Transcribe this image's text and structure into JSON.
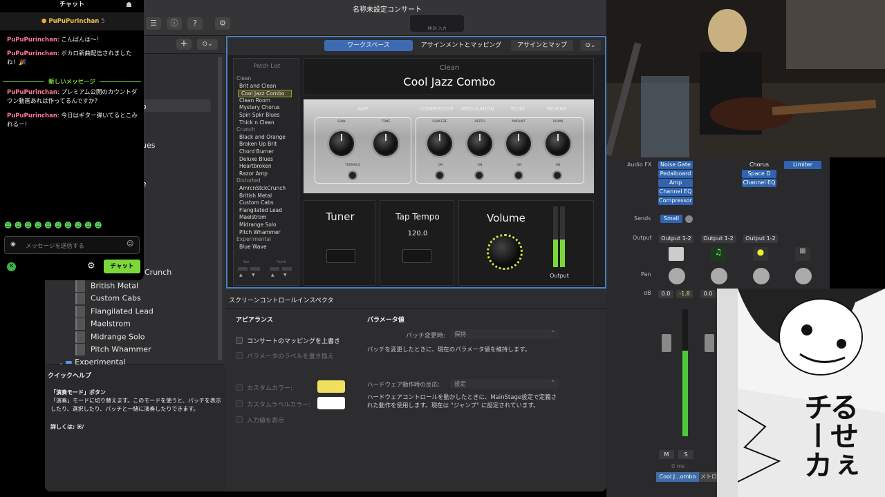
{
  "window": {
    "title": "名称未設定コンサート",
    "midi": "MIDI 入力"
  },
  "chat": {
    "title": "チャット",
    "owner": "PuPuPurinchan",
    "owner_count": "5",
    "messages": [
      {
        "user": "PuPuPurinchan",
        "text": ": こんばんは〜！"
      },
      {
        "user": "PuPuPurinchan",
        "text": ": ボカロ新曲配信されましたね！🎉"
      },
      {
        "user": "PuPuPurinchan",
        "text": ": プレミアム公開のカウントダウン動画あれは作ってるんですか？"
      },
      {
        "user": "PuPuPurinchan",
        "text": ": 今日はギター弾いてるとこみれるー！"
      }
    ],
    "new_divider": "新しいメッセージ",
    "placeholder": "メッセージを送信する",
    "send": "チャット"
  },
  "left": {
    "fragments": [
      "o",
      "ues",
      "e"
    ],
    "items": [
      "Crunch",
      "British Metal",
      "Custom Cabs",
      "Flangilated Lead",
      "Maelstrom",
      "Midrange Solo",
      "Pitch Whammer"
    ],
    "folder": "Experimental"
  },
  "quickhelp": {
    "title": "クイックヘルプ",
    "heading": "「演奏モード」ボタン",
    "body": "「演奏」モードに切り替えます。このモードを使うと、パッチを表示したり、選択したり、パッチと一緒に演奏したりできます。",
    "more": "詳しくは: ⌘/"
  },
  "workspace": {
    "tabs": [
      "ワークスペース",
      "アサインメントとマッピング",
      "アサインとマップ"
    ],
    "patch_list_title": "Patch List",
    "patch_list": [
      {
        "t": "Clean",
        "cat": true
      },
      {
        "t": "Brit and Clean"
      },
      {
        "t": "Cool Jazz Combo",
        "sel": true
      },
      {
        "t": "Clean Room"
      },
      {
        "t": "Mystery Chorus"
      },
      {
        "t": "Spin Spkr Blues"
      },
      {
        "t": "Thick n Clean"
      },
      {
        "t": "Crunch",
        "cat": true
      },
      {
        "t": "Black and Orange"
      },
      {
        "t": "Broken Up Brit"
      },
      {
        "t": "Chord Burner"
      },
      {
        "t": "Deluxe Blues"
      },
      {
        "t": "Heartbroken"
      },
      {
        "t": "Razor Amp"
      },
      {
        "t": "Distorted",
        "cat": true
      },
      {
        "t": "AmrcnStckCrunch"
      },
      {
        "t": "British Metal"
      },
      {
        "t": "Custom Cabs"
      },
      {
        "t": "Flangilated Lead"
      },
      {
        "t": "Maelstrom"
      },
      {
        "t": "Midrange Solo"
      },
      {
        "t": "Pitch Whammer"
      },
      {
        "t": "Experimental",
        "cat": true
      },
      {
        "t": "Blue Wave"
      }
    ],
    "set_label": "Set",
    "patch_label": "Patch",
    "category": "Clean",
    "patch_name": "Cool Jazz Combo",
    "amp": {
      "sections": [
        "AMP",
        "COMPRESSOR",
        "MODULATION",
        "ECHO",
        "REVERB"
      ],
      "knobs": [
        "GAIN",
        "TONE",
        "SQUEEZE",
        "DEPTH",
        "AMOUNT",
        "ROOM"
      ],
      "tremolo": "TREMOLO",
      "on": "ON"
    },
    "tuner": "Tuner",
    "tap_tempo": "Tap Tempo",
    "tempo": "120.0",
    "volume": "Volume",
    "output": "Output"
  },
  "inspector": {
    "title": "スクリーンコントロールインスペクタ",
    "appearance": "アピアランス",
    "override": "コンサートのマッピングを上書き",
    "replace_labels": "パラメータのラベルを置き換え",
    "custom_color": "カスタムカラー:",
    "custom_label_color": "カスタムラベルカラー:",
    "show_input": "入力値を表示",
    "param_value": "パラメータ値",
    "patch_change": "パッチ変更時:",
    "patch_change_val": "保持",
    "patch_change_desc": "パッチを変更したときに、現在のパラメータ値を維持します。",
    "hw_response": "ハードウェア動作時の反応:",
    "hw_response_val": "設定",
    "hw_desc": "ハードウェアコントロールを動かしたときに、MainStage設定で定義された動作を使用します。現在は \"ジャンプ\" に設定されています。",
    "colors": {
      "custom": "#f0e060",
      "label": "#ffffff"
    }
  },
  "mixer": {
    "audio_fx": "Audio FX",
    "fx1": [
      "Noise Gate",
      "Pedalboard",
      "Amp",
      "Channel EQ",
      "Compressor"
    ],
    "fx3": [
      "Chorus",
      "Space D",
      "Channel EQ"
    ],
    "fx4": [
      "Limiter"
    ],
    "sends": "Sends",
    "send_val": "Small",
    "output": "Output",
    "outputs": [
      "Output 1-2",
      "Output 1-2",
      "Output 1-2"
    ],
    "pan": "Pan",
    "db": "dB",
    "db_vals": [
      "0.0",
      "-1.8",
      "0.0"
    ],
    "mute": "M",
    "solo": "S",
    "ms": "0 ms",
    "strip_name": "Cool J...ombo",
    "strip_name2": "メトロ"
  },
  "manga": {
    "text": "るせぇチーカ"
  }
}
